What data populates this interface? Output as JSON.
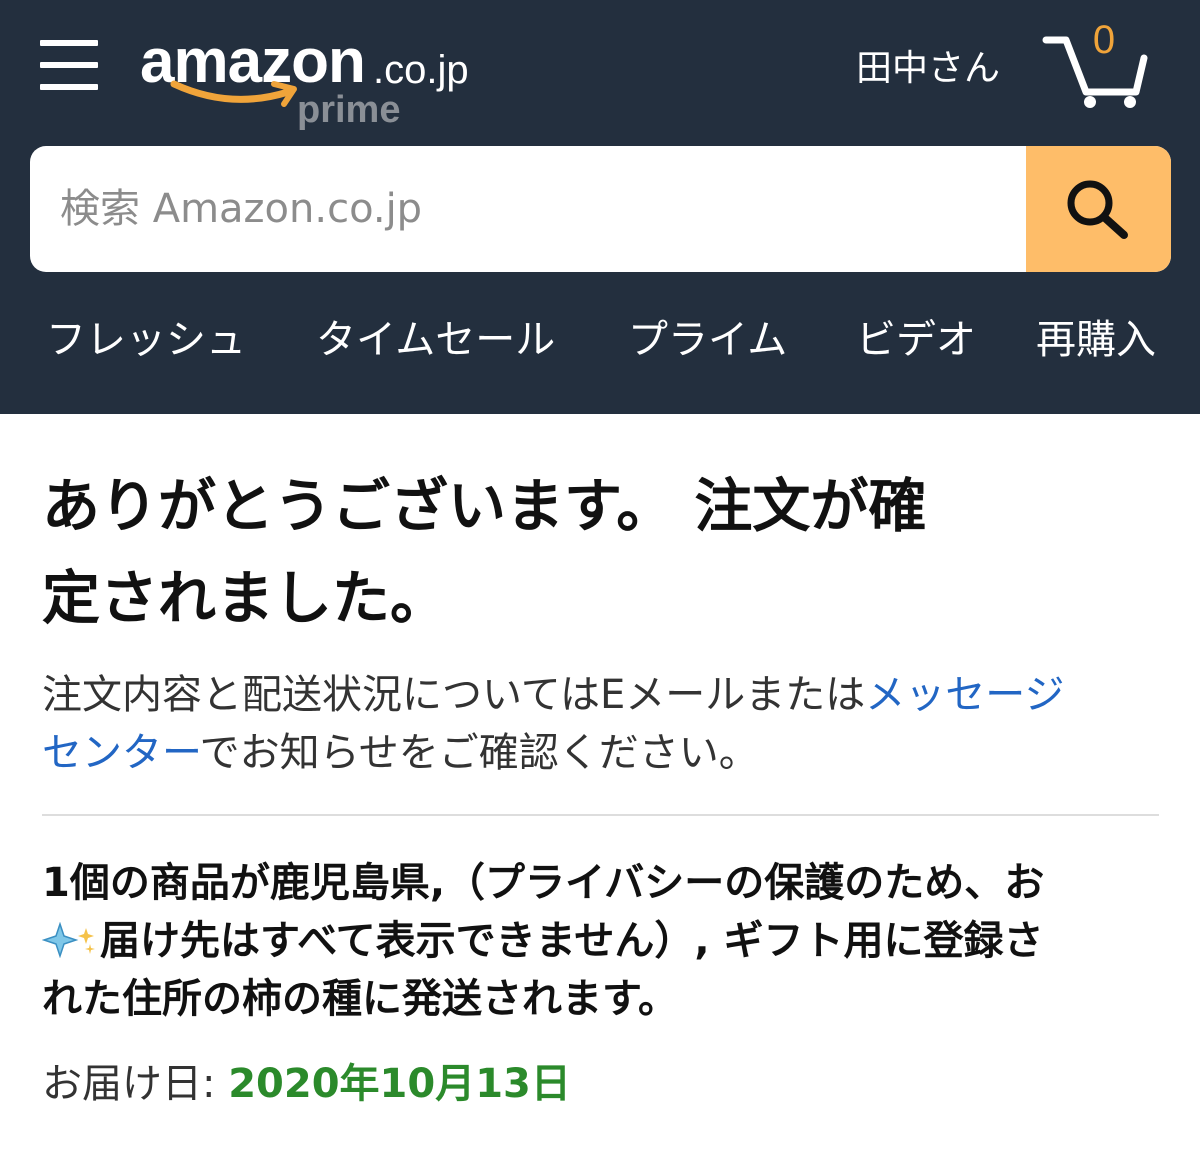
{
  "header": {
    "logo": {
      "main": "amazon",
      "domain": ".co.jp",
      "tier": "prime"
    },
    "user_name": "田中さん",
    "cart_count": "0",
    "icons": {
      "menu": "hamburger-menu-icon",
      "cart": "cart-icon",
      "search": "magnifier-icon"
    },
    "colors": {
      "background": "#232f3e",
      "search_button": "#febd69",
      "cart_count": "#f0a43a"
    }
  },
  "search": {
    "placeholder": "検索 Amazon.co.jp",
    "value": ""
  },
  "nav": {
    "items": [
      {
        "label": "フレッシュ"
      },
      {
        "label": "タイムセール"
      },
      {
        "label": "プライム"
      },
      {
        "label": "ビデオ"
      },
      {
        "label": "再購入"
      }
    ]
  },
  "confirmation": {
    "heading_line1": "ありがとうございます。 注文が確",
    "heading_line2": "定されました。",
    "info_text": "注文内容と配送状況についてはEメールまたは",
    "info_link_1": "メッセージ",
    "info_link_2": "センター",
    "info_text_end": "でお知らせをご確認ください。",
    "shipping_line1": "1個の商品が鹿児島県,（プライバシーの保護のため、お",
    "shipping_line2": "届け先はすべて表示できません）, ギフト用に登録さ",
    "shipping_line3": "れた住所の柿の種に発送されます。",
    "delivery_label": "お届け日: ",
    "delivery_date": "2020年10月13日",
    "colors": {
      "link": "#2266c4",
      "delivery_date": "#2b8a2b"
    }
  }
}
